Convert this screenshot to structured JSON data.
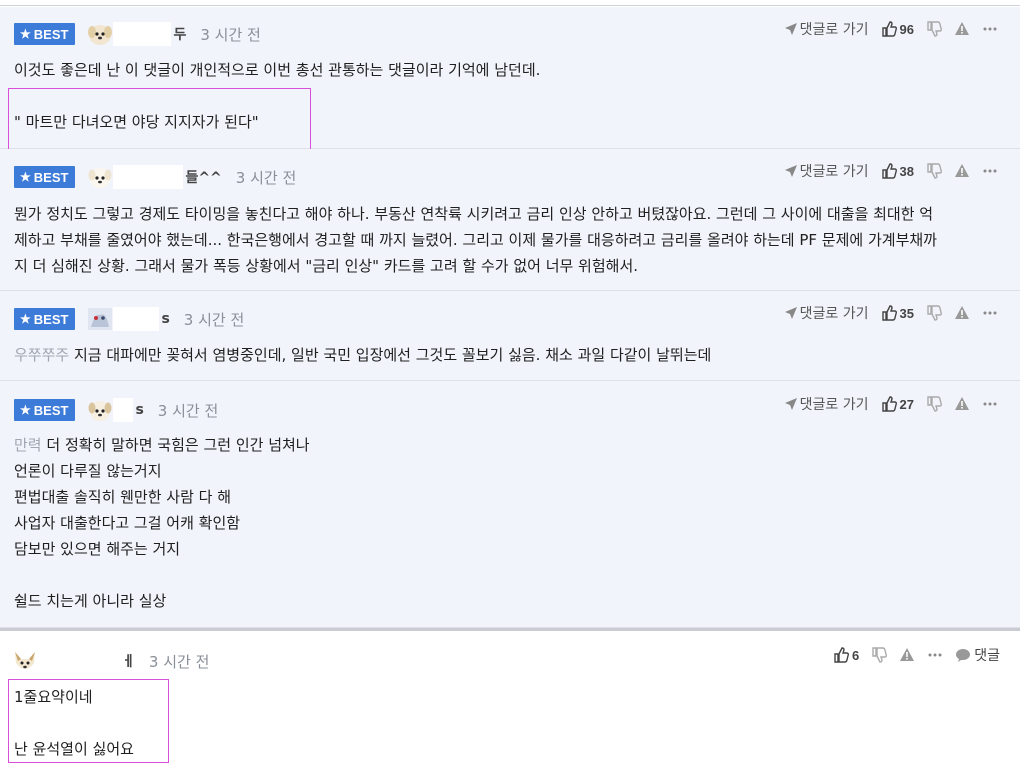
{
  "comments": [
    {
      "badge": "BEST",
      "nick_tail": "두",
      "time": "3 시간 전",
      "goto_label": "댓글로 가기",
      "likes": "96",
      "lines": [
        "이것도 좋은데 난 이 댓글이 개인적으로 이번 총선 관통하는 댓글이라 기억에 남던데.",
        "",
        "\" 마트만 다녀오면 야당 지지자가 된다\""
      ]
    },
    {
      "badge": "BEST",
      "nick_tail": "들^^",
      "time": "3 시간 전",
      "goto_label": "댓글로 가기",
      "likes": "38",
      "lines": [
        "뭔가 정치도 그렇고 경제도 타이밍을 놓친다고 해야 하나. 부동산 연착륙 시키려고 금리 인상 안하고 버텼잖아요. 그런데 그 사이에 대출을 최대한 억",
        "제하고 부채를 줄였어야 했는데... 한국은행에서 경고할 때 까지 늘렸어. 그리고 이제 물가를 대응하려고 금리를 올려야 하는데 PF 문제에 가계부채까",
        "지 더 심해진 상황. 그래서 물가 폭등 상황에서 \"금리 인상\" 카드를 고려 할 수가 없어 너무 위험해서."
      ]
    },
    {
      "badge": "BEST",
      "nick_tail": "s",
      "time": "3 시간 전",
      "goto_label": "댓글로 가기",
      "likes": "35",
      "quote_tag": "우쭈쭈주",
      "lines": [
        "지금 대파에만 꽂혀서 염병중인데, 일반 국민 입장에선 그것도 꼴보기 싫음. 채소 과일 다같이 날뛰는데"
      ]
    },
    {
      "badge": "BEST",
      "nick_tail": "s",
      "time": "3 시간 전",
      "goto_label": "댓글로 가기",
      "likes": "27",
      "quote_tag": "만력",
      "lines": [
        "더 정확히 말하면 국힘은 그런 인간 넘쳐나",
        "언론이 다루질 않는거지",
        "편법대출 솔직히 웬만한 사람 다 해",
        "사업자 대출한다고 그걸 어캐 확인함",
        "담보만 있으면 해주는 거지",
        "",
        "쉴드 치는게 아니라 실상"
      ]
    },
    {
      "nick_tail": "ㅔ",
      "time": "3 시간 전",
      "likes": "6",
      "reply_label": "댓글",
      "lines": [
        "1줄요약이네",
        "",
        "난 윤석열이 싫어요"
      ]
    }
  ]
}
